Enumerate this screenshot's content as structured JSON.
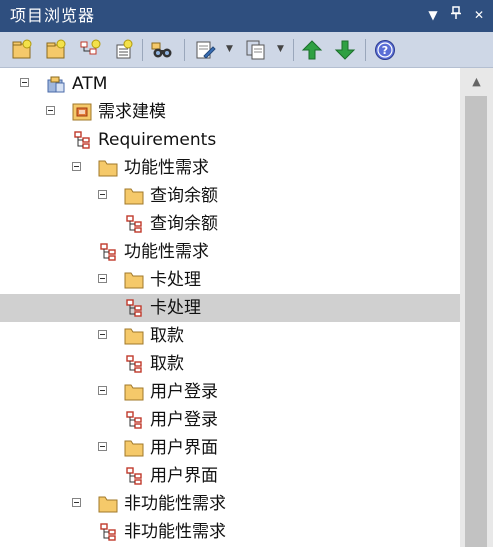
{
  "panel": {
    "title": "项目浏览器"
  },
  "title_buttons": [
    {
      "name": "dropdown-arrow-icon",
      "glyph": "▼"
    },
    {
      "name": "pin-icon",
      "glyph": "⊥"
    },
    {
      "name": "close-icon",
      "glyph": "✕"
    }
  ],
  "toolbar": {
    "buttons": [
      "new-model-icon",
      "new-package-icon",
      "new-diagram-icon",
      "new-element-icon",
      "search-binoculars-icon",
      "documentation-icon",
      "copy-icon",
      "move-up-icon",
      "move-down-icon",
      "help-icon"
    ]
  },
  "tree": [
    {
      "label": "ATM",
      "type": "model",
      "indent": 0,
      "expanded": true
    },
    {
      "label": "需求建模",
      "type": "package-root",
      "indent": 1,
      "expanded": true
    },
    {
      "label": "Requirements",
      "type": "diagram",
      "indent": 2
    },
    {
      "label": "功能性需求",
      "type": "folder",
      "indent": 2,
      "expanded": true
    },
    {
      "label": "查询余额",
      "type": "folder",
      "indent": 3,
      "expanded": true
    },
    {
      "label": "查询余额",
      "type": "diagram",
      "indent": 4
    },
    {
      "label": "功能性需求",
      "type": "diagram",
      "indent": 3
    },
    {
      "label": "卡处理",
      "type": "folder",
      "indent": 3,
      "expanded": true
    },
    {
      "label": "卡处理",
      "type": "diagram",
      "indent": 4,
      "selected": true
    },
    {
      "label": "取款",
      "type": "folder",
      "indent": 3,
      "expanded": true
    },
    {
      "label": "取款",
      "type": "diagram",
      "indent": 4
    },
    {
      "label": "用户登录",
      "type": "folder",
      "indent": 3,
      "expanded": true
    },
    {
      "label": "用户登录",
      "type": "diagram",
      "indent": 4
    },
    {
      "label": "用户界面",
      "type": "folder",
      "indent": 3,
      "expanded": true
    },
    {
      "label": "用户界面",
      "type": "diagram",
      "indent": 4
    },
    {
      "label": "非功能性需求",
      "type": "folder",
      "indent": 2,
      "expanded": true
    },
    {
      "label": "非功能性需求",
      "type": "diagram",
      "indent": 3
    }
  ],
  "colors": {
    "title_bg": "#2f4f7f",
    "toolbar_bg": "#ced7e6",
    "selected_row": "#d0d0d0",
    "folder": "#f5c96a",
    "diagram_red": "#c0392b"
  }
}
